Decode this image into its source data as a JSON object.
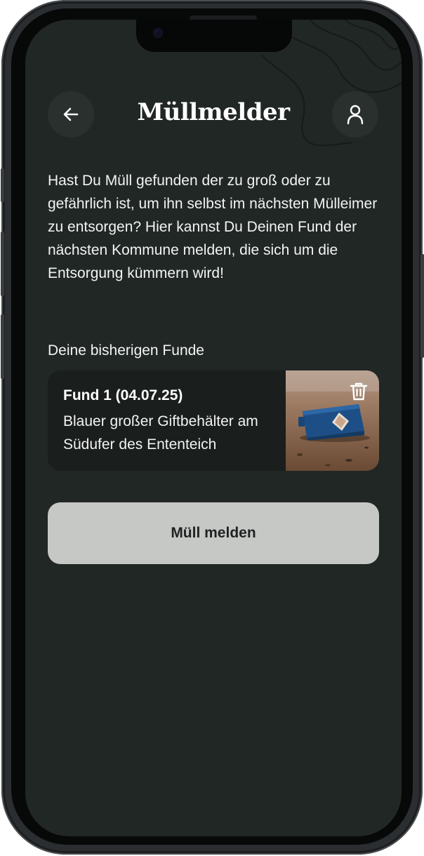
{
  "header": {
    "title": "Müllmelder",
    "back_icon": "arrow-left-icon",
    "profile_icon": "user-icon"
  },
  "intro": {
    "text": "Hast Du Müll gefunden der zu groß oder zu gefährlich ist, um ihn selbst im nächsten Mülleimer zu entsorgen? Hier kannst Du Deinen Fund der nächsten Kommune melden, die sich um die Entsorgung kümmern wird!"
  },
  "funde": {
    "label": "Deine bisherigen Funde",
    "items": [
      {
        "title": "Fund 1 (04.07.25)",
        "description": "Blauer großer Giftbehälter am Südufer des Ententeich",
        "delete_icon": "trash-icon"
      }
    ]
  },
  "actions": {
    "report_label": "Müll melden"
  },
  "colors": {
    "screen_background": "#212725",
    "card_background": "#1a1e1d",
    "button_background": "#c6c8c6",
    "text": "#f2f4f3"
  }
}
